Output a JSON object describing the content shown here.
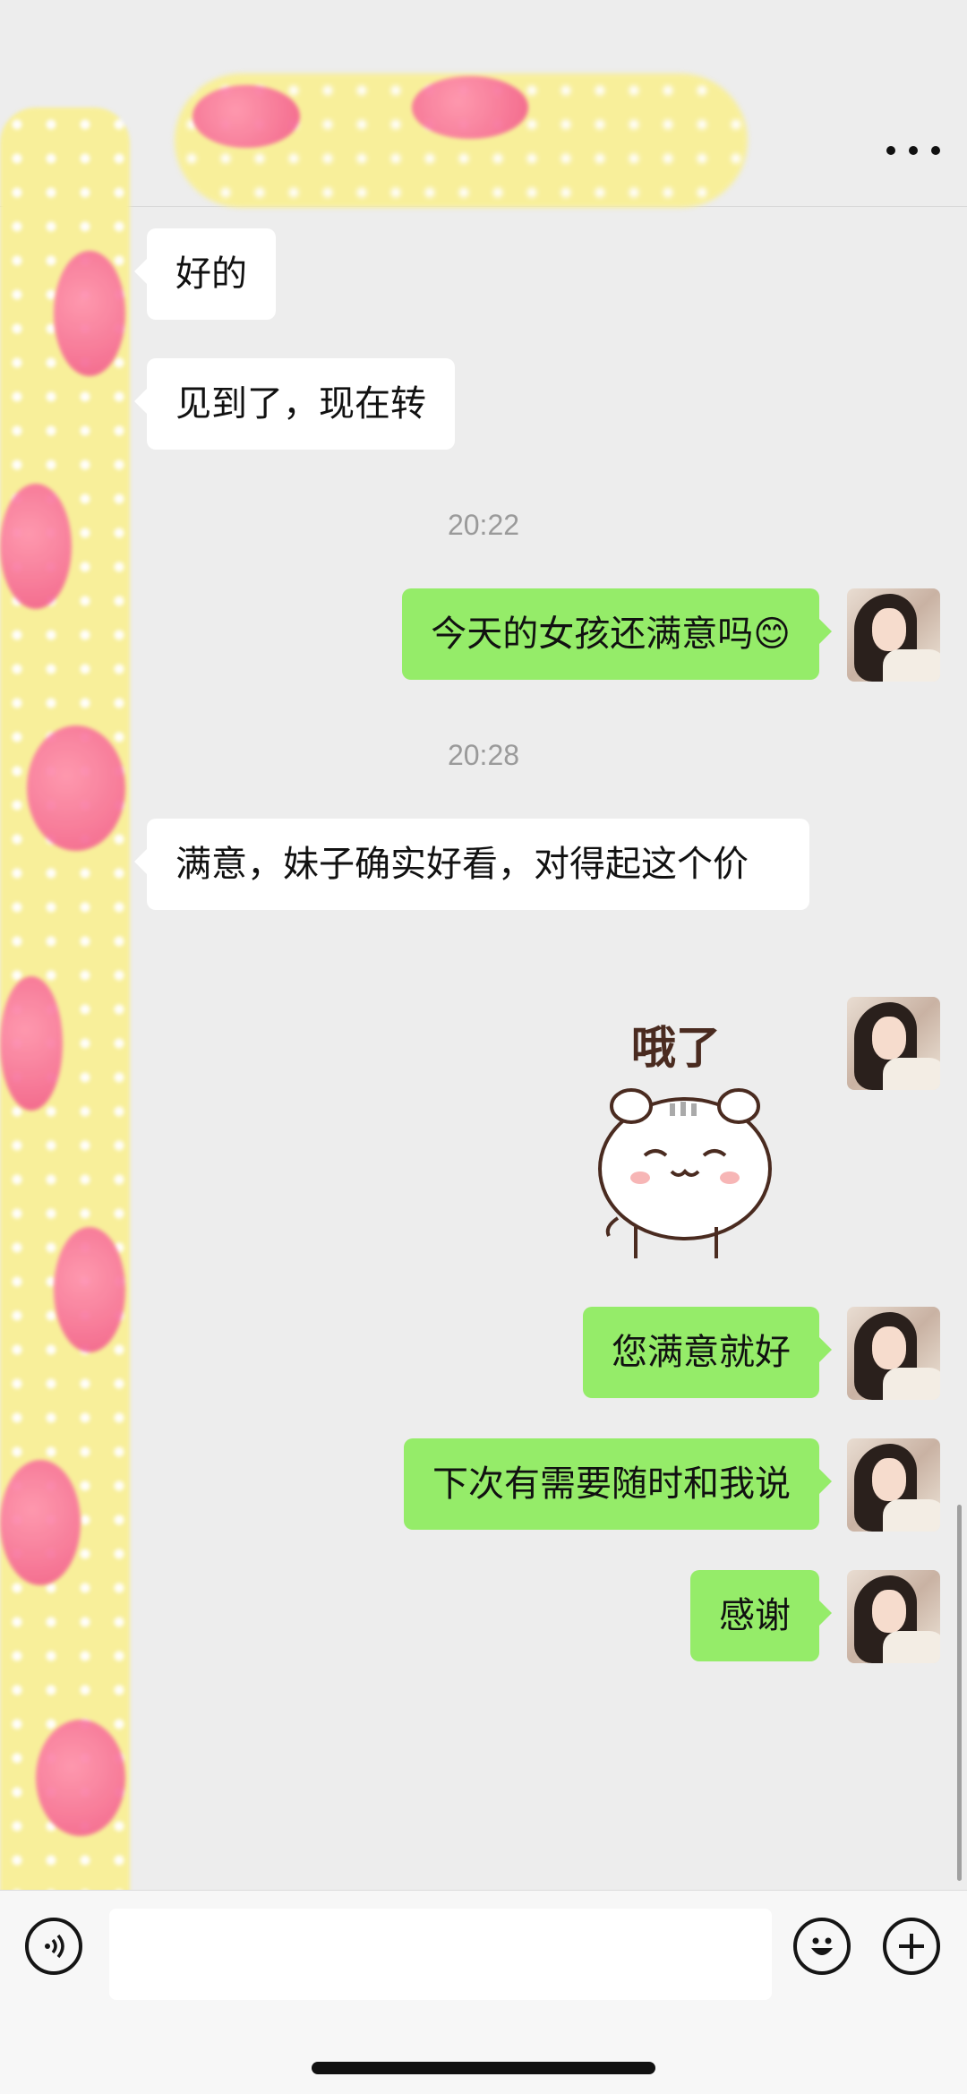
{
  "header": {
    "more_icon": "more-dots-icon"
  },
  "messages": [
    {
      "side": "left",
      "text": "好的"
    },
    {
      "side": "left",
      "text": "见到了，现在转"
    },
    {
      "type": "time",
      "text": "20:22"
    },
    {
      "side": "right",
      "text": "今天的女孩还满意吗😊"
    },
    {
      "type": "time",
      "text": "20:28"
    },
    {
      "side": "left",
      "text": " 满意，妹子确实好看，对得起这个价"
    },
    {
      "side": "right",
      "type": "sticker",
      "text": "哦了"
    },
    {
      "side": "right",
      "text": "您满意就好"
    },
    {
      "side": "right",
      "text": "下次有需要随时和我说"
    },
    {
      "side": "right",
      "text": "感谢"
    }
  ],
  "input_bar": {
    "voice_icon": "voice-icon",
    "emoji_icon": "emoji-icon",
    "plus_icon": "plus-icon",
    "placeholder": ""
  },
  "colors": {
    "incoming": "#ffffff",
    "outgoing": "#95ec69",
    "background": "#ededed"
  }
}
